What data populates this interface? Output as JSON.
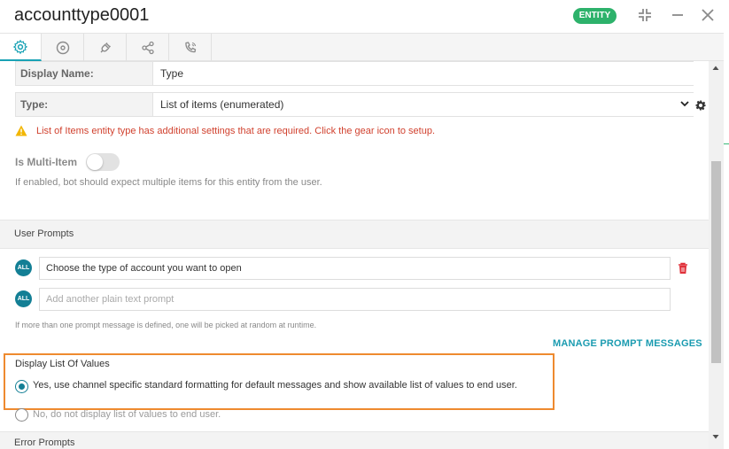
{
  "window": {
    "title": "accounttype0001",
    "badge": "ENTITY"
  },
  "tabs": [
    {
      "icon": "gear-icon",
      "active": true
    },
    {
      "icon": "disc-icon",
      "active": false
    },
    {
      "icon": "plug-icon",
      "active": false
    },
    {
      "icon": "share-nodes-icon",
      "active": false
    },
    {
      "icon": "phone-icon",
      "active": false
    }
  ],
  "form": {
    "display_name_label": "Display Name:",
    "display_name_value": "Type",
    "type_label": "Type:",
    "type_value": "List of items (enumerated)",
    "warning": "List of Items entity type has additional settings that are required. Click the gear icon to setup.",
    "multi_item_label": "Is Multi-Item",
    "multi_item_enabled": false,
    "multi_item_help": "If enabled, bot should expect multiple items for this entity from the user."
  },
  "user_prompts": {
    "title": "User Prompts",
    "badge": "ALL",
    "prompt_value": "Choose the type of account you want to open",
    "add_placeholder": "Add another plain text prompt",
    "help": "If more than one prompt message is defined, one will be picked at random at runtime.",
    "manage_link": "MANAGE PROMPT MESSAGES"
  },
  "display_list": {
    "title": "Display List Of Values",
    "option_yes": "Yes, use channel specific standard formatting for default messages and show available list of values to end user.",
    "option_no": "No, do not display list of values to end user.",
    "selected": "yes"
  },
  "error_prompts": {
    "title": "Error Prompts"
  },
  "colors": {
    "accent": "#137f95",
    "badge_green": "#2db26b",
    "warning_red": "#d1422f",
    "highlight_orange": "#ee8a2f"
  }
}
